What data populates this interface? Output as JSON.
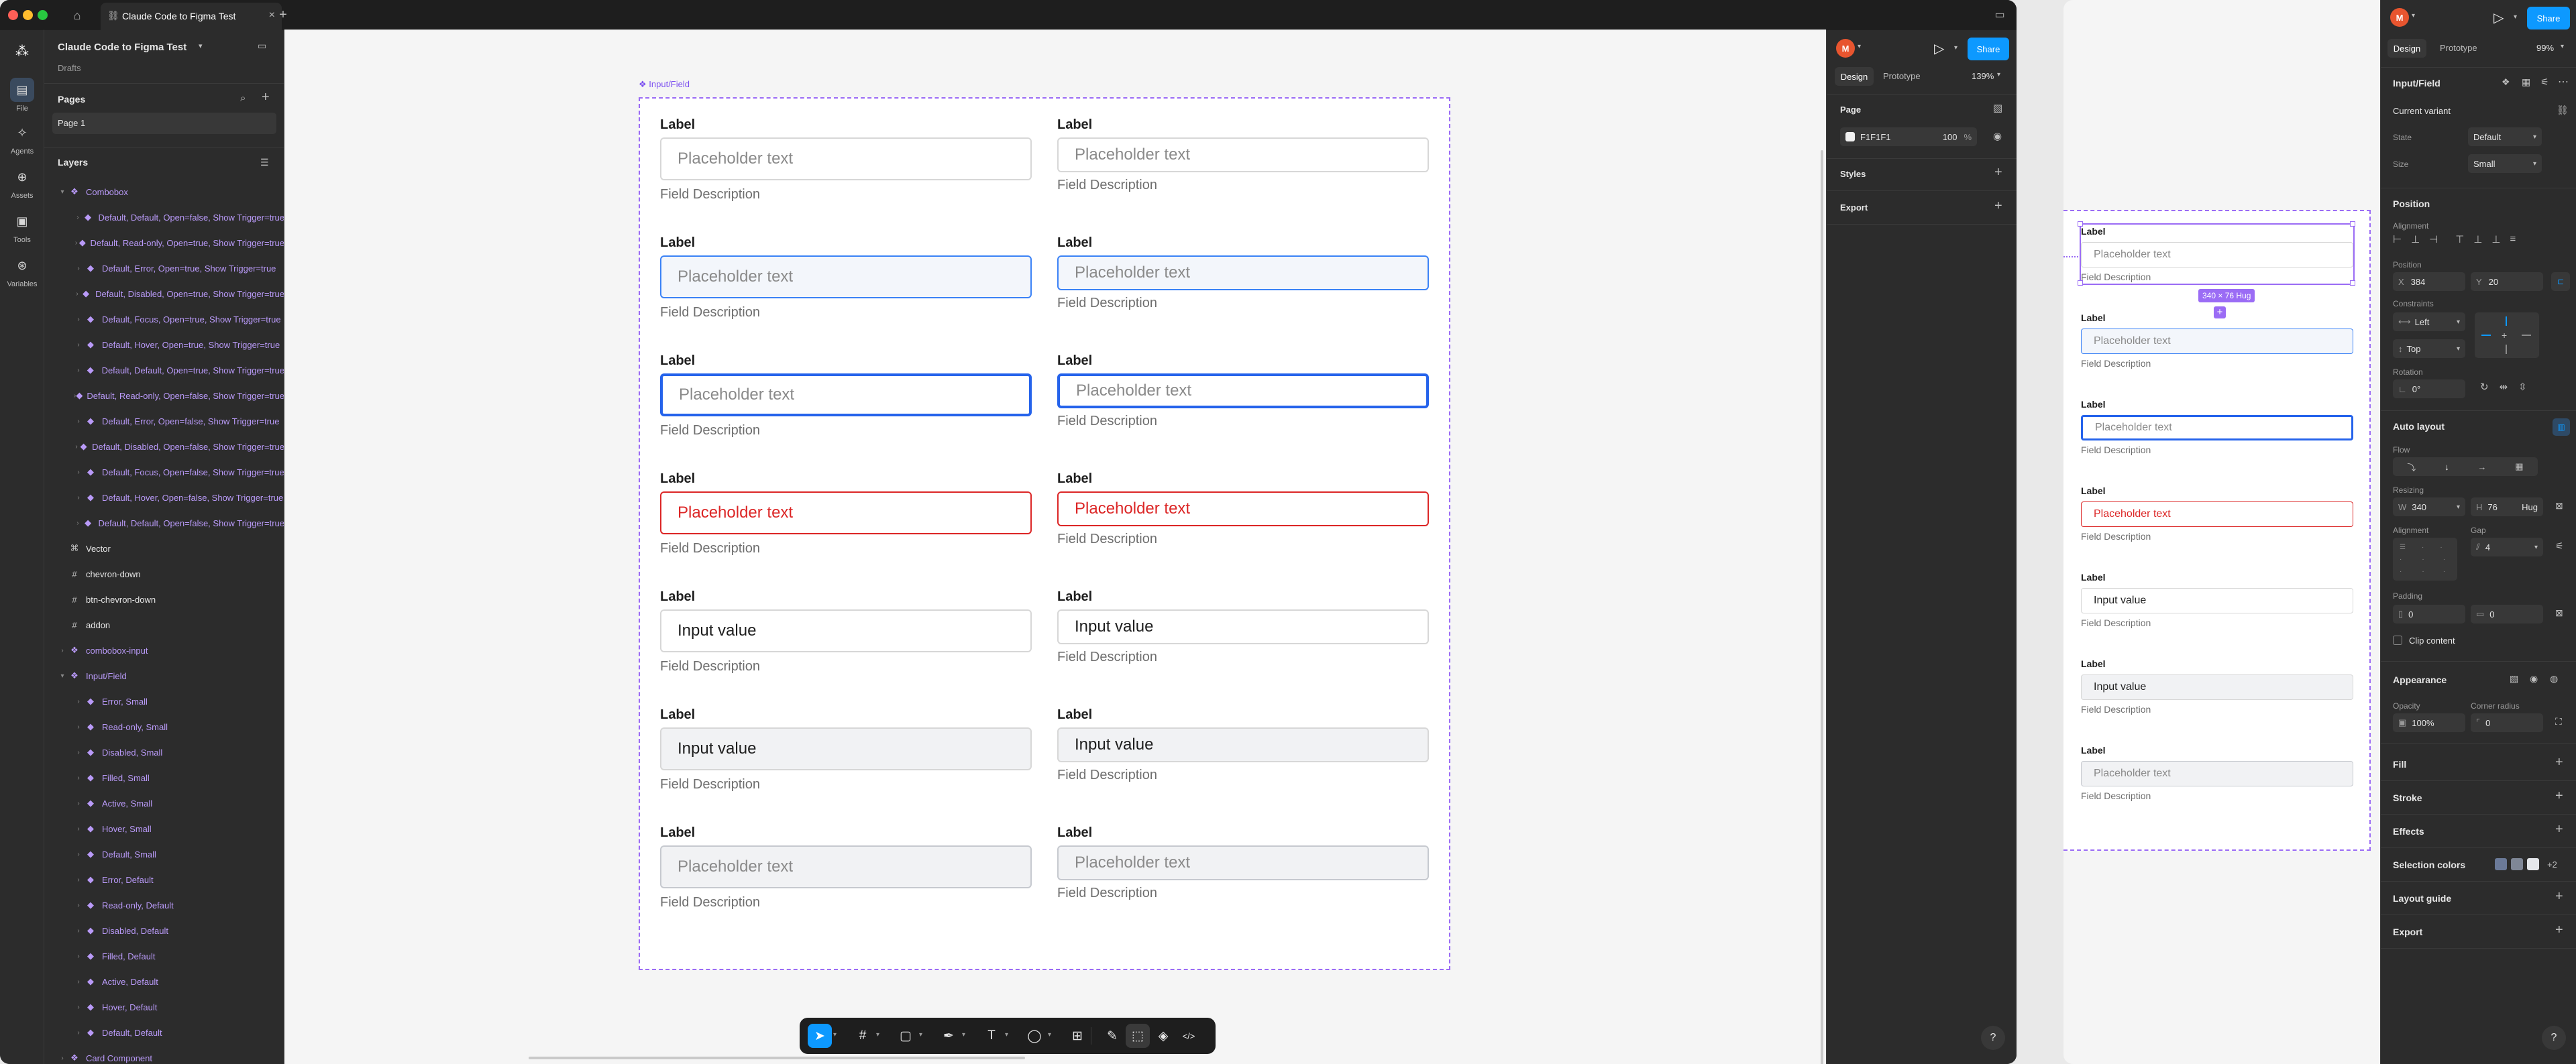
{
  "tabs": {
    "active_title": "Claude Code to Figma Test"
  },
  "rail": [
    {
      "label": "File",
      "icon": "file-icon"
    },
    {
      "label": "Agents",
      "icon": "agents-icon"
    },
    {
      "label": "Assets",
      "icon": "assets-icon"
    },
    {
      "label": "Tools",
      "icon": "tools-icon"
    },
    {
      "label": "Variables",
      "icon": "variables-icon"
    }
  ],
  "file": {
    "name": "Claude Code to Figma Test",
    "project": "Drafts"
  },
  "pages": {
    "title": "Pages",
    "items": [
      "Page 1"
    ]
  },
  "layers": {
    "title": "Layers",
    "items": [
      {
        "label": "Combobox",
        "depth": 0,
        "kind": "component-set",
        "open": true
      },
      {
        "label": "Default, Default, Open=false, Show Trigger=true",
        "depth": 1,
        "kind": "variant"
      },
      {
        "label": "Default, Read-only, Open=true, Show Trigger=true",
        "depth": 1,
        "kind": "variant"
      },
      {
        "label": "Default, Error, Open=true, Show Trigger=true",
        "depth": 1,
        "kind": "variant"
      },
      {
        "label": "Default, Disabled, Open=true, Show Trigger=true",
        "depth": 1,
        "kind": "variant"
      },
      {
        "label": "Default, Focus, Open=true, Show Trigger=true",
        "depth": 1,
        "kind": "variant"
      },
      {
        "label": "Default, Hover, Open=true, Show Trigger=true",
        "depth": 1,
        "kind": "variant"
      },
      {
        "label": "Default, Default, Open=true, Show Trigger=true",
        "depth": 1,
        "kind": "variant"
      },
      {
        "label": "Default, Read-only, Open=false, Show Trigger=true",
        "depth": 1,
        "kind": "variant"
      },
      {
        "label": "Default, Error, Open=false, Show Trigger=true",
        "depth": 1,
        "kind": "variant"
      },
      {
        "label": "Default, Disabled, Open=false, Show Trigger=true",
        "depth": 1,
        "kind": "variant"
      },
      {
        "label": "Default, Focus, Open=false, Show Trigger=true",
        "depth": 1,
        "kind": "variant"
      },
      {
        "label": "Default, Hover, Open=false, Show Trigger=true",
        "depth": 1,
        "kind": "variant"
      },
      {
        "label": "Default, Default, Open=false, Show Trigger=true",
        "depth": 1,
        "kind": "variant"
      },
      {
        "label": "Vector",
        "depth": 0,
        "kind": "vector"
      },
      {
        "label": "chevron-down",
        "depth": 0,
        "kind": "frame"
      },
      {
        "label": "btn-chevron-down",
        "depth": 0,
        "kind": "frame"
      },
      {
        "label": "addon",
        "depth": 0,
        "kind": "frame"
      },
      {
        "label": "combobox-input",
        "depth": 0,
        "kind": "component",
        "collapsed": true
      },
      {
        "label": "Input/Field",
        "depth": 0,
        "kind": "component-set",
        "open": true
      },
      {
        "label": "Error, Small",
        "depth": 1,
        "kind": "variant"
      },
      {
        "label": "Read-only, Small",
        "depth": 1,
        "kind": "variant"
      },
      {
        "label": "Disabled, Small",
        "depth": 1,
        "kind": "variant"
      },
      {
        "label": "Filled, Small",
        "depth": 1,
        "kind": "variant"
      },
      {
        "label": "Active, Small",
        "depth": 1,
        "kind": "variant"
      },
      {
        "label": "Hover, Small",
        "depth": 1,
        "kind": "variant"
      },
      {
        "label": "Default, Small",
        "depth": 1,
        "kind": "variant"
      },
      {
        "label": "Error, Default",
        "depth": 1,
        "kind": "variant"
      },
      {
        "label": "Read-only, Default",
        "depth": 1,
        "kind": "variant"
      },
      {
        "label": "Disabled, Default",
        "depth": 1,
        "kind": "variant"
      },
      {
        "label": "Filled, Default",
        "depth": 1,
        "kind": "variant"
      },
      {
        "label": "Active, Default",
        "depth": 1,
        "kind": "variant"
      },
      {
        "label": "Hover, Default",
        "depth": 1,
        "kind": "variant"
      },
      {
        "label": "Default, Default",
        "depth": 1,
        "kind": "variant"
      },
      {
        "label": "Card Component",
        "depth": 0,
        "kind": "component-set",
        "collapsed": true
      }
    ]
  },
  "canvas": {
    "frame_label": "Input/Field",
    "left_column": [
      {
        "label": "Label",
        "text": "Placeholder text",
        "desc": "Field Description",
        "state": "default"
      },
      {
        "label": "Label",
        "text": "Placeholder text",
        "desc": "Field Description",
        "state": "hover"
      },
      {
        "label": "Label",
        "text": "Placeholder text",
        "desc": "Field Description",
        "state": "active"
      },
      {
        "label": "Label",
        "text": "Placeholder text",
        "desc": "Field Description",
        "state": "error"
      },
      {
        "label": "Label",
        "text": "Input value",
        "desc": "Field Description",
        "state": "filled"
      },
      {
        "label": "Label",
        "text": "Input value",
        "desc": "Field Description",
        "state": "readonly"
      },
      {
        "label": "Label",
        "text": "Placeholder text",
        "desc": "Field Description",
        "state": "disabled"
      }
    ],
    "right_column": [
      {
        "label": "Label",
        "text": "Placeholder text",
        "desc": "Field Description",
        "state": "default"
      },
      {
        "label": "Label",
        "text": "Placeholder text",
        "desc": "Field Description",
        "state": "hover"
      },
      {
        "label": "Label",
        "text": "Placeholder text",
        "desc": "Field Description",
        "state": "active"
      },
      {
        "label": "Label",
        "text": "Placeholder text",
        "desc": "Field Description",
        "state": "error"
      },
      {
        "label": "Label",
        "text": "Input value",
        "desc": "Field Description",
        "state": "filled"
      },
      {
        "label": "Label",
        "text": "Input value",
        "desc": "Field Description",
        "state": "readonly"
      },
      {
        "label": "Label",
        "text": "Placeholder text",
        "desc": "Field Description",
        "state": "disabled"
      }
    ]
  },
  "toolbar": {
    "tools": [
      "move-tool-icon",
      "frame-tool-icon",
      "shape-tool-icon",
      "pen-tool-icon",
      "text-tool-icon",
      "comment-tool-icon",
      "actions-icon",
      "draw-mode-icon",
      "design-mode-icon",
      "prototype-mode-icon",
      "dev-mode-icon"
    ]
  },
  "panel1": {
    "avatar": "M",
    "share": "Share",
    "tab_design": "Design",
    "tab_prototype": "Prototype",
    "zoom": "139%",
    "page_section": "Page",
    "page_color": "F1F1F1",
    "page_opacity": "100",
    "percent": "%",
    "styles": "Styles",
    "export": "Export",
    "help": "?"
  },
  "canvas2": {
    "size_badge": "340 × 76 Hug",
    "fields": [
      {
        "label": "Label",
        "text": "Placeholder text",
        "desc": "Field Description",
        "state": "selected"
      },
      {
        "label": "Label",
        "text": "Placeholder text",
        "desc": "Field Description",
        "state": "hover"
      },
      {
        "label": "Label",
        "text": "Placeholder text",
        "desc": "Field Description",
        "state": "active"
      },
      {
        "label": "Label",
        "text": "Placeholder text",
        "desc": "Field Description",
        "state": "error"
      },
      {
        "label": "Label",
        "text": "Input value",
        "desc": "Field Description",
        "state": "filled"
      },
      {
        "label": "Label",
        "text": "Input value",
        "desc": "Field Description",
        "state": "readonly"
      },
      {
        "label": "Label",
        "text": "Placeholder text",
        "desc": "Field Description",
        "state": "disabled"
      }
    ]
  },
  "panel2": {
    "avatar": "M",
    "share": "Share",
    "tab_design": "Design",
    "tab_prototype": "Prototype",
    "zoom": "99%",
    "component_name": "Input/Field",
    "current_variant": "Current variant",
    "state_label": "State",
    "state_value": "Default",
    "size_label": "Size",
    "size_value": "Small",
    "position": "Position",
    "alignment": "Alignment",
    "position_sub": "Position",
    "x_label": "X",
    "x": "384",
    "y_label": "Y",
    "y": "20",
    "constraints": "Constraints",
    "constraint_h": "Left",
    "constraint_v": "Top",
    "rotation": "Rotation",
    "rotation_value": "0°",
    "auto_layout": "Auto layout",
    "flow": "Flow",
    "resizing": "Resizing",
    "w_label": "W",
    "w": "340",
    "h_label": "H",
    "h": "76",
    "hug": "Hug",
    "al_alignment": "Alignment",
    "gap": "Gap",
    "gap_value": "4",
    "padding": "Padding",
    "pad_h": "0",
    "pad_v": "0",
    "clip_content": "Clip content",
    "appearance": "Appearance",
    "opacity": "Opacity",
    "opacity_value": "100%",
    "corner_radius": "Corner radius",
    "corner_value": "0",
    "fill": "Fill",
    "stroke": "Stroke",
    "effects": "Effects",
    "selection_colors": "Selection colors",
    "selection_more": "+2",
    "layout_guide": "Layout guide",
    "export": "Export",
    "help": "?"
  },
  "colors": {
    "accent": "#0d99ff",
    "component": "#9b6cf5",
    "focus": "#2563eb",
    "hover": "#3b82f6",
    "error": "#dc2626",
    "avatar": "#e8552f"
  }
}
